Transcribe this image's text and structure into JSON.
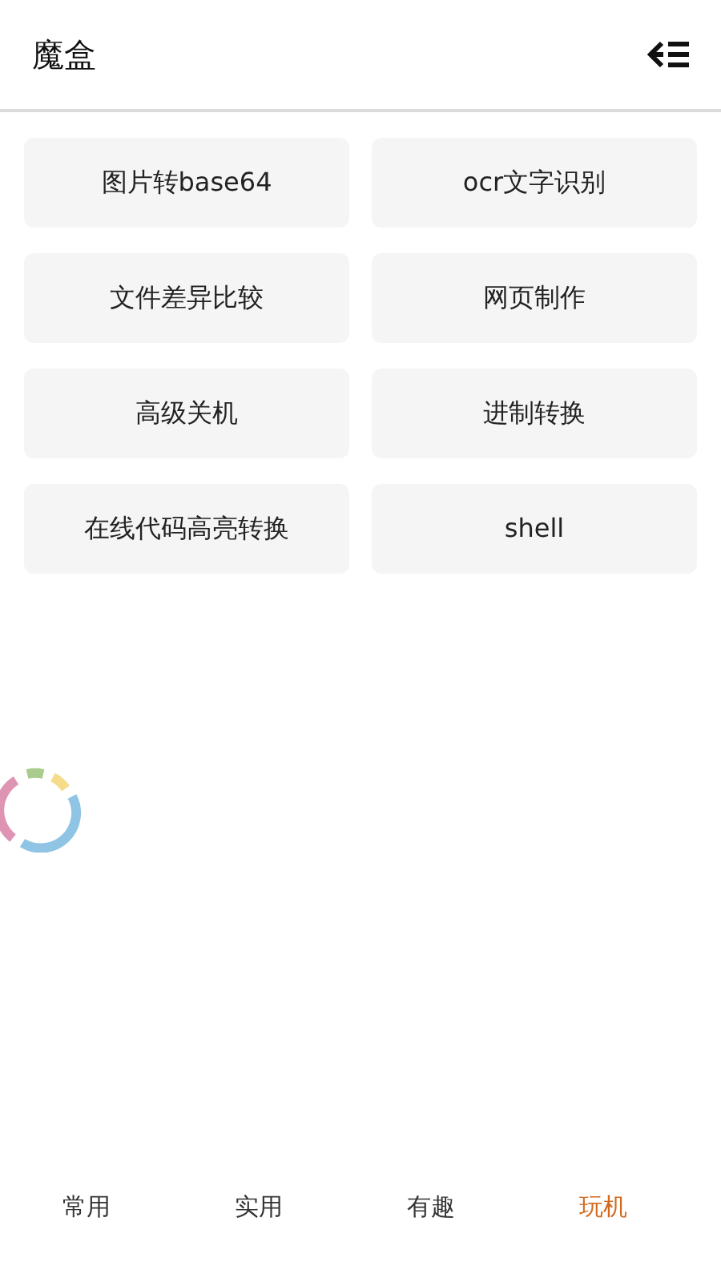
{
  "header": {
    "title": "魔盒"
  },
  "tools": [
    {
      "label": "图片转base64"
    },
    {
      "label": "ocr文字识别"
    },
    {
      "label": "文件差异比较"
    },
    {
      "label": "网页制作"
    },
    {
      "label": "高级关机"
    },
    {
      "label": "进制转换"
    },
    {
      "label": "在线代码高亮转换"
    },
    {
      "label": "shell"
    }
  ],
  "bottom_nav": [
    {
      "label": "常用",
      "selected": false
    },
    {
      "label": "实用",
      "selected": false
    },
    {
      "label": "有趣",
      "selected": false
    },
    {
      "label": "玩机",
      "selected": true
    }
  ]
}
